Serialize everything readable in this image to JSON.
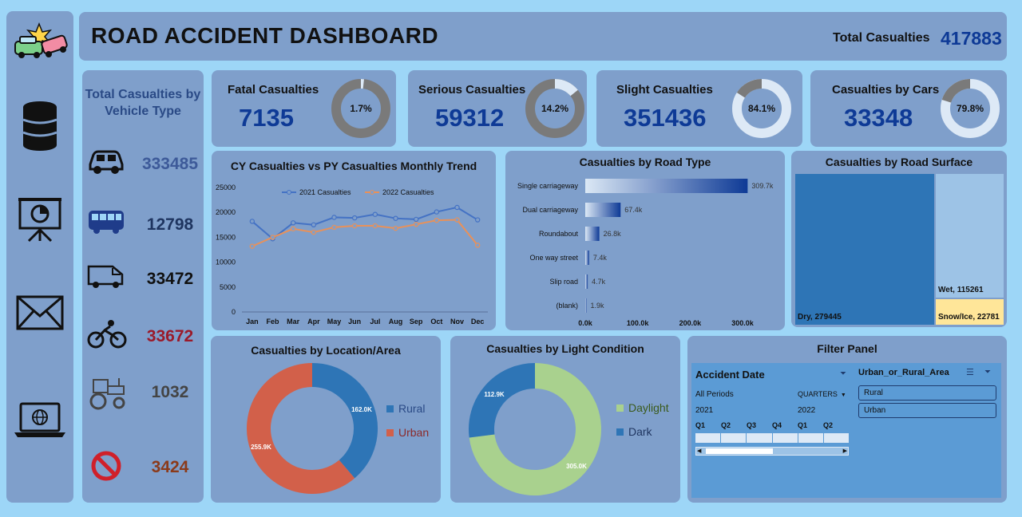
{
  "header": {
    "title": "ROAD ACCIDENT DASHBOARD",
    "total_label": "Total Casualties",
    "total_value": "417883"
  },
  "sidebar": {
    "icons": [
      "car-crash-icon",
      "database-icon",
      "presentation-chart-icon",
      "mail-icon",
      "laptop-globe-icon"
    ]
  },
  "kpis": [
    {
      "label": "Fatal Casualties",
      "value": "7135",
      "pct": "1.7%",
      "fraction": 0.017
    },
    {
      "label": "Serious Casualties",
      "value": "59312",
      "pct": "14.2%",
      "fraction": 0.142
    },
    {
      "label": "Slight Casualties",
      "value": "351436",
      "pct": "84.1%",
      "fraction": 0.841
    },
    {
      "label": "Casualties by Cars",
      "value": "33348",
      "pct": "79.8%",
      "fraction": 0.798
    }
  ],
  "vehicle": {
    "title_line1": "Total Casualties by",
    "title_line2": "Vehicle Type",
    "items": [
      {
        "icon": "car-icon",
        "value": "333485",
        "color": "#3d5a99"
      },
      {
        "icon": "bus-icon",
        "value": "12798",
        "color": "#1f3560"
      },
      {
        "icon": "van-icon",
        "value": "33472",
        "color": "#111111"
      },
      {
        "icon": "bicycle-icon",
        "value": "33672",
        "color": "#9a1a2a"
      },
      {
        "icon": "tractor-icon",
        "value": "1032",
        "color": "#444444"
      },
      {
        "icon": "no-entry-icon",
        "value": "3424",
        "color": "#8b3a1a"
      }
    ]
  },
  "trend": {
    "title": "CY Casualties vs PY Casualties Monthly Trend",
    "chart_data": {
      "type": "line",
      "x": [
        "Jan",
        "Feb",
        "Mar",
        "Apr",
        "May",
        "Jun",
        "Jul",
        "Aug",
        "Sep",
        "Oct",
        "Nov",
        "Dec"
      ],
      "series": [
        {
          "name": "2021 Casualties",
          "color": "#4472c4",
          "values": [
            18200,
            14700,
            17900,
            17500,
            19000,
            18900,
            19600,
            18800,
            18600,
            20100,
            21000,
            18500
          ]
        },
        {
          "name": "2022 Casualties",
          "color": "#e8915a",
          "values": [
            13200,
            15000,
            16700,
            16000,
            17000,
            17300,
            17300,
            16800,
            17600,
            18400,
            18500,
            13400
          ]
        }
      ],
      "yticks": [
        "25000",
        "20000",
        "15000",
        "10000",
        "5000",
        "0"
      ],
      "ylim": [
        0,
        25000
      ]
    }
  },
  "road_type": {
    "title": "Casualties by Road Type",
    "chart_data": {
      "type": "bar",
      "categories": [
        "Single carriageway",
        "Dual carriageway",
        "Roundabout",
        "One way street",
        "Slip road",
        "(blank)"
      ],
      "values": [
        309700,
        67400,
        26800,
        7400,
        4700,
        1900
      ],
      "labels": [
        "309.7k",
        "67.4k",
        "26.8k",
        "7.4k",
        "4.7k",
        "1.9k"
      ],
      "xticks": [
        "0.0k",
        "100.0k",
        "200.0k",
        "300.0k"
      ],
      "xlim": [
        0,
        300000
      ]
    }
  },
  "road_surface": {
    "title": "Casualties by Road Surface",
    "chart_data": {
      "type": "treemap",
      "items": [
        {
          "label": "Dry, 279445",
          "value": 279445,
          "color": "#2e75b6"
        },
        {
          "label": "Wet, 115261",
          "value": 115261,
          "color": "#9dc3e6"
        },
        {
          "label": "Snow/Ice, 22781",
          "value": 22781,
          "color": "#ffe699"
        }
      ]
    }
  },
  "location": {
    "title": "Casualties by Location/Area",
    "chart_data": {
      "type": "pie",
      "slices": [
        {
          "name": "Rural",
          "value": 162000,
          "label": "162.0K",
          "color": "#2e75b6"
        },
        {
          "name": "Urban",
          "value": 255900,
          "label": "255.9K",
          "color": "#d2604a"
        }
      ]
    }
  },
  "light": {
    "title": "Casualties by Light Condition",
    "chart_data": {
      "type": "pie",
      "slices": [
        {
          "name": "Daylight",
          "value": 305000,
          "label": "305.0K",
          "color": "#a9d18e"
        },
        {
          "name": "Dark",
          "value": 112900,
          "label": "112.9K",
          "color": "#2e75b6"
        }
      ]
    }
  },
  "filter": {
    "title": "Filter Panel",
    "date_label": "Accident Date",
    "all_periods": "All Periods",
    "quarters": "QUARTERS",
    "year1": "2021",
    "year2": "2022",
    "q_labels": [
      "Q1",
      "Q2",
      "Q3",
      "Q4",
      "Q1",
      "Q2"
    ],
    "area_label": "Urban_or_Rural_Area",
    "options": [
      "Rural",
      "Urban"
    ]
  }
}
